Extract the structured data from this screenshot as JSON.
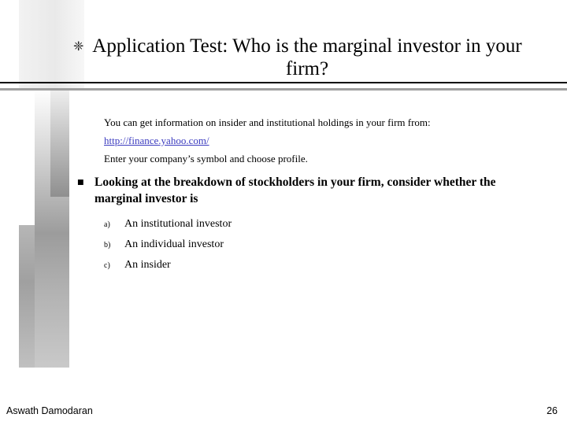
{
  "slide": {
    "title": "Application Test: Who is the marginal investor in your firm?",
    "title_bullet_glyph": "❈",
    "intro_lines": [
      "You can get information on insider and institutional holdings in your firm from:",
      "http://finance.yahoo.com/",
      "Enter your company’s symbol and choose profile."
    ],
    "link_text": "http://finance.yahoo.com/",
    "link_color": "#3b3bbf",
    "main_bullet_marker": "■",
    "main_bullet": "Looking at the breakdown of stockholders in your firm, consider whether the marginal investor is",
    "options": [
      {
        "marker": "a)",
        "text": "An institutional investor"
      },
      {
        "marker": "b)",
        "text": "An individual investor"
      },
      {
        "marker": "c)",
        "text": "An insider"
      }
    ],
    "footer": {
      "author": "Aswath Damodaran",
      "page_number": "26"
    }
  }
}
